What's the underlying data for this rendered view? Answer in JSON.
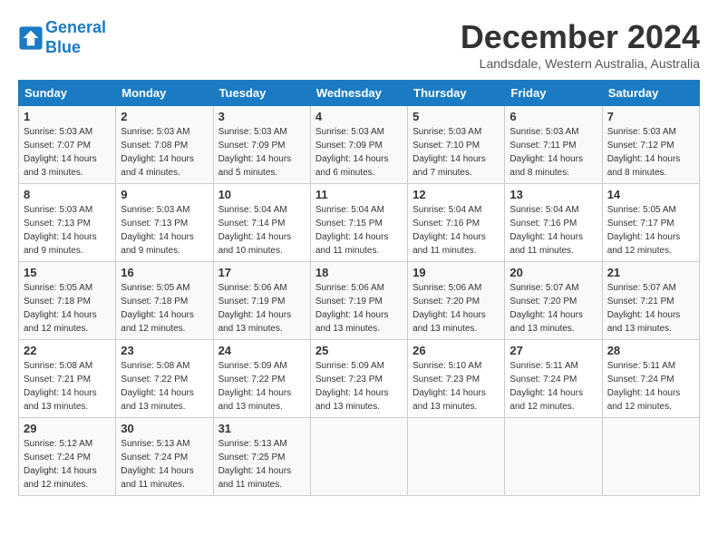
{
  "header": {
    "logo_line1": "General",
    "logo_line2": "Blue",
    "title": "December 2024",
    "location": "Landsdale, Western Australia, Australia"
  },
  "days_of_week": [
    "Sunday",
    "Monday",
    "Tuesday",
    "Wednesday",
    "Thursday",
    "Friday",
    "Saturday"
  ],
  "weeks": [
    [
      {
        "day": 1,
        "info": "Sunrise: 5:03 AM\nSunset: 7:07 PM\nDaylight: 14 hours\nand 3 minutes."
      },
      {
        "day": 2,
        "info": "Sunrise: 5:03 AM\nSunset: 7:08 PM\nDaylight: 14 hours\nand 4 minutes."
      },
      {
        "day": 3,
        "info": "Sunrise: 5:03 AM\nSunset: 7:09 PM\nDaylight: 14 hours\nand 5 minutes."
      },
      {
        "day": 4,
        "info": "Sunrise: 5:03 AM\nSunset: 7:09 PM\nDaylight: 14 hours\nand 6 minutes."
      },
      {
        "day": 5,
        "info": "Sunrise: 5:03 AM\nSunset: 7:10 PM\nDaylight: 14 hours\nand 7 minutes."
      },
      {
        "day": 6,
        "info": "Sunrise: 5:03 AM\nSunset: 7:11 PM\nDaylight: 14 hours\nand 8 minutes."
      },
      {
        "day": 7,
        "info": "Sunrise: 5:03 AM\nSunset: 7:12 PM\nDaylight: 14 hours\nand 8 minutes."
      }
    ],
    [
      {
        "day": 8,
        "info": "Sunrise: 5:03 AM\nSunset: 7:13 PM\nDaylight: 14 hours\nand 9 minutes."
      },
      {
        "day": 9,
        "info": "Sunrise: 5:03 AM\nSunset: 7:13 PM\nDaylight: 14 hours\nand 9 minutes."
      },
      {
        "day": 10,
        "info": "Sunrise: 5:04 AM\nSunset: 7:14 PM\nDaylight: 14 hours\nand 10 minutes."
      },
      {
        "day": 11,
        "info": "Sunrise: 5:04 AM\nSunset: 7:15 PM\nDaylight: 14 hours\nand 11 minutes."
      },
      {
        "day": 12,
        "info": "Sunrise: 5:04 AM\nSunset: 7:16 PM\nDaylight: 14 hours\nand 11 minutes."
      },
      {
        "day": 13,
        "info": "Sunrise: 5:04 AM\nSunset: 7:16 PM\nDaylight: 14 hours\nand 11 minutes."
      },
      {
        "day": 14,
        "info": "Sunrise: 5:05 AM\nSunset: 7:17 PM\nDaylight: 14 hours\nand 12 minutes."
      }
    ],
    [
      {
        "day": 15,
        "info": "Sunrise: 5:05 AM\nSunset: 7:18 PM\nDaylight: 14 hours\nand 12 minutes."
      },
      {
        "day": 16,
        "info": "Sunrise: 5:05 AM\nSunset: 7:18 PM\nDaylight: 14 hours\nand 12 minutes."
      },
      {
        "day": 17,
        "info": "Sunrise: 5:06 AM\nSunset: 7:19 PM\nDaylight: 14 hours\nand 13 minutes."
      },
      {
        "day": 18,
        "info": "Sunrise: 5:06 AM\nSunset: 7:19 PM\nDaylight: 14 hours\nand 13 minutes."
      },
      {
        "day": 19,
        "info": "Sunrise: 5:06 AM\nSunset: 7:20 PM\nDaylight: 14 hours\nand 13 minutes."
      },
      {
        "day": 20,
        "info": "Sunrise: 5:07 AM\nSunset: 7:20 PM\nDaylight: 14 hours\nand 13 minutes."
      },
      {
        "day": 21,
        "info": "Sunrise: 5:07 AM\nSunset: 7:21 PM\nDaylight: 14 hours\nand 13 minutes."
      }
    ],
    [
      {
        "day": 22,
        "info": "Sunrise: 5:08 AM\nSunset: 7:21 PM\nDaylight: 14 hours\nand 13 minutes."
      },
      {
        "day": 23,
        "info": "Sunrise: 5:08 AM\nSunset: 7:22 PM\nDaylight: 14 hours\nand 13 minutes."
      },
      {
        "day": 24,
        "info": "Sunrise: 5:09 AM\nSunset: 7:22 PM\nDaylight: 14 hours\nand 13 minutes."
      },
      {
        "day": 25,
        "info": "Sunrise: 5:09 AM\nSunset: 7:23 PM\nDaylight: 14 hours\nand 13 minutes."
      },
      {
        "day": 26,
        "info": "Sunrise: 5:10 AM\nSunset: 7:23 PM\nDaylight: 14 hours\nand 13 minutes."
      },
      {
        "day": 27,
        "info": "Sunrise: 5:11 AM\nSunset: 7:24 PM\nDaylight: 14 hours\nand 12 minutes."
      },
      {
        "day": 28,
        "info": "Sunrise: 5:11 AM\nSunset: 7:24 PM\nDaylight: 14 hours\nand 12 minutes."
      }
    ],
    [
      {
        "day": 29,
        "info": "Sunrise: 5:12 AM\nSunset: 7:24 PM\nDaylight: 14 hours\nand 12 minutes."
      },
      {
        "day": 30,
        "info": "Sunrise: 5:13 AM\nSunset: 7:24 PM\nDaylight: 14 hours\nand 11 minutes."
      },
      {
        "day": 31,
        "info": "Sunrise: 5:13 AM\nSunset: 7:25 PM\nDaylight: 14 hours\nand 11 minutes."
      },
      null,
      null,
      null,
      null
    ]
  ]
}
